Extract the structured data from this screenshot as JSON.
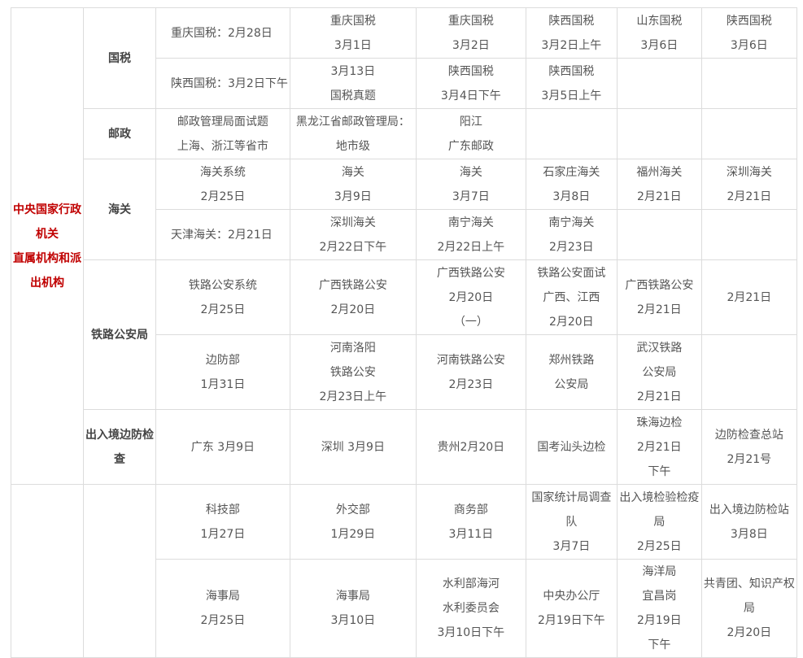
{
  "groups": [
    {
      "org": [
        "中央国家行政",
        "机关",
        "直属机构和派",
        "出机构"
      ],
      "cats": [
        {
          "label": [
            "国税"
          ],
          "rows": [
            [
              [
                "重庆国税：2月28日"
              ],
              [
                "重庆国税",
                "3月1日"
              ],
              [
                "重庆国税",
                "3月2日"
              ],
              [
                "陕西国税",
                "3月2日上午"
              ],
              [
                "山东国税",
                "3月6日"
              ],
              [
                "陕西国税",
                "3月6日"
              ]
            ],
            [
              [
                "陕西国税：3月2日下午"
              ],
              [
                "3月13日",
                "国税真题"
              ],
              [
                "陕西国税",
                "3月4日下午"
              ],
              [
                "陕西国税",
                "3月5日上午"
              ],
              [],
              []
            ]
          ]
        },
        {
          "label": [
            "邮政"
          ],
          "rows": [
            [
              [
                "邮政管理局面试题",
                "上海、浙江等省市"
              ],
              [
                "黑龙江省邮政管理局：",
                "地市级"
              ],
              [
                "阳江",
                "广东邮政"
              ],
              [],
              [],
              []
            ]
          ]
        },
        {
          "label": [
            "海关"
          ],
          "rows": [
            [
              [
                "海关系统",
                "2月25日"
              ],
              [
                "海关",
                "3月9日"
              ],
              [
                "海关",
                "3月7日"
              ],
              [
                "石家庄海关",
                "3月8日"
              ],
              [
                "福州海关",
                "2月21日"
              ],
              [
                "深圳海关",
                "2月21日"
              ]
            ],
            [
              [
                "天津海关：2月21日"
              ],
              [
                "深圳海关",
                "2月22日下午"
              ],
              [
                "南宁海关",
                "2月22日上午"
              ],
              [
                "南宁海关",
                "2月23日"
              ],
              [],
              []
            ]
          ]
        },
        {
          "label": [
            "铁路公安局"
          ],
          "rows": [
            [
              [
                "铁路公安系统",
                "2月25日"
              ],
              [
                "广西铁路公安",
                "2月20日"
              ],
              [
                "广西铁路公安",
                "2月20日",
                "（一）"
              ],
              [
                "铁路公安面试",
                "广西、江西",
                "2月20日"
              ],
              [
                "广西铁路公安",
                "2月21日"
              ],
              [
                "2月21日"
              ]
            ],
            [
              [
                "边防部",
                "1月31日"
              ],
              [
                "河南洛阳",
                "铁路公安",
                "2月23日上午"
              ],
              [
                "河南铁路公安",
                "2月23日"
              ],
              [
                "郑州铁路",
                "公安局"
              ],
              [
                "武汉铁路",
                "公安局",
                "2月21日"
              ],
              []
            ]
          ]
        },
        {
          "label": [
            "出入境边防检",
            "查"
          ],
          "rows": [
            [
              [
                "广东 3月9日"
              ],
              [
                "深圳 3月9日"
              ],
              [
                "贵州2月20日"
              ],
              [
                "国考汕头边检"
              ],
              [
                "珠海边检",
                "2月21日",
                "下午"
              ],
              [
                "边防检查总站",
                "2月21号"
              ]
            ]
          ]
        }
      ]
    },
    {
      "org": [],
      "cats": [
        {
          "label": [],
          "rows": [
            [
              [
                "科技部",
                "1月27日"
              ],
              [
                "外交部",
                "1月29日"
              ],
              [
                "商务部",
                "3月11日"
              ],
              [
                "国家统计局调查",
                "队",
                "3月7日"
              ],
              [
                "出入境检验检疫",
                "局",
                "2月25日"
              ],
              [
                "出入境边防检站",
                "3月8日"
              ]
            ],
            [
              [
                "海事局",
                "2月25日"
              ],
              [
                "海事局",
                "3月10日"
              ],
              [
                "水利部海河",
                "水利委员会",
                "3月10日下午"
              ],
              [
                "中央办公厅",
                "2月19日下午"
              ],
              [
                "海洋局",
                "宜昌岗",
                "2月19日",
                "下午"
              ],
              [
                "共青团、知识产权",
                "局",
                "2月20日"
              ]
            ]
          ]
        }
      ]
    }
  ]
}
